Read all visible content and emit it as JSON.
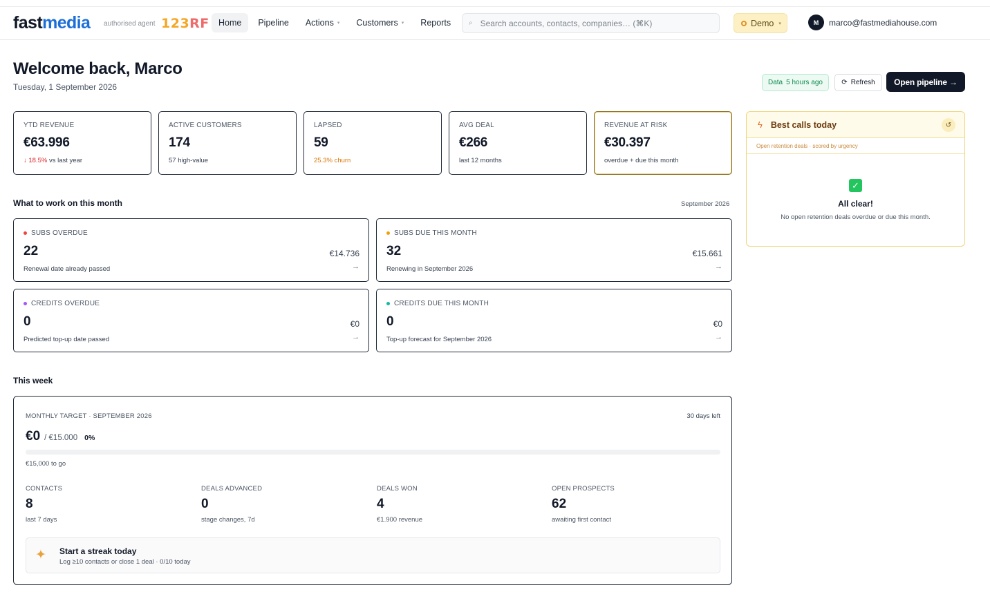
{
  "header": {
    "logo_fast": "fast",
    "logo_media": "media",
    "agent_label": "authorised agent",
    "partner_a": "123",
    "partner_b": "RF",
    "nav": [
      {
        "label": "Home"
      },
      {
        "label": "Pipeline"
      },
      {
        "label": "Actions"
      },
      {
        "label": "Customers"
      },
      {
        "label": "Reports"
      }
    ],
    "search_placeholder": "Search accounts, contacts, companies… (⌘K)",
    "demo_label": "Demo",
    "user_initial": "M",
    "user_email": "marco@fastmediahouse.com"
  },
  "page": {
    "welcome": "Welcome back, Marco",
    "date": "Tuesday, 1 September 2026",
    "data_label": "Data",
    "data_age": "5 hours ago",
    "refresh_label": "Refresh",
    "open_pipeline_label": "Open pipeline →"
  },
  "kpis": [
    {
      "label": "YTD REVENUE",
      "value": "€63.996",
      "sub_delta": "↓ 18.5%",
      "sub_text": " vs last year"
    },
    {
      "label": "ACTIVE CUSTOMERS",
      "value": "174",
      "sub_text": "57 high-value"
    },
    {
      "label": "LAPSED",
      "value": "59",
      "sub_warn": "25.3% churn"
    },
    {
      "label": "AVG DEAL",
      "value": "€266",
      "sub_text": "last 12 months"
    },
    {
      "label": "REVENUE AT RISK",
      "value": "€30.397",
      "sub_text": "overdue + due this month"
    }
  ],
  "best_calls": {
    "title": "Best calls today",
    "subtitle": "Open retention deals · scored by urgency",
    "status": "All clear!",
    "message": "No open retention deals overdue or due this month."
  },
  "work": {
    "title": "What to work on this month",
    "month": "September 2026",
    "cards": [
      {
        "label": "SUBS OVERDUE",
        "count": "22",
        "desc": "Renewal date already passed",
        "amount": "€14.736",
        "dot_color": "#ef4444"
      },
      {
        "label": "SUBS DUE THIS MONTH",
        "count": "32",
        "desc": "Renewing in September 2026",
        "amount": "€15.661",
        "dot_color": "#f59e0b"
      },
      {
        "label": "CREDITS OVERDUE",
        "count": "0",
        "desc": "Predicted top-up date passed",
        "amount": "€0",
        "dot_color": "#a855f7"
      },
      {
        "label": "CREDITS DUE THIS MONTH",
        "count": "0",
        "desc": "Top-up forecast for September 2026",
        "amount": "€0",
        "dot_color": "#14b8a6"
      }
    ]
  },
  "week": {
    "title": "This week",
    "target_label": "MONTHLY TARGET · SEPTEMBER 2026",
    "days_left": "30 days left",
    "achieved": "€0",
    "target": "/ €15.000",
    "percent": "0%",
    "progress_fraction": 0,
    "to_go": "€15,000 to go",
    "stats": [
      {
        "label": "CONTACTS",
        "value": "8",
        "sub": "last 7 days"
      },
      {
        "label": "DEALS ADVANCED",
        "value": "0",
        "sub": "stage changes, 7d"
      },
      {
        "label": "DEALS WON",
        "value": "4",
        "sub": "€1.900 revenue"
      },
      {
        "label": "OPEN PROSPECTS",
        "value": "62",
        "sub": "awaiting first contact"
      }
    ],
    "streak_title": "Start a streak today",
    "streak_sub": "Log ≥10 contacts or close 1 deal · 0/10 today"
  }
}
